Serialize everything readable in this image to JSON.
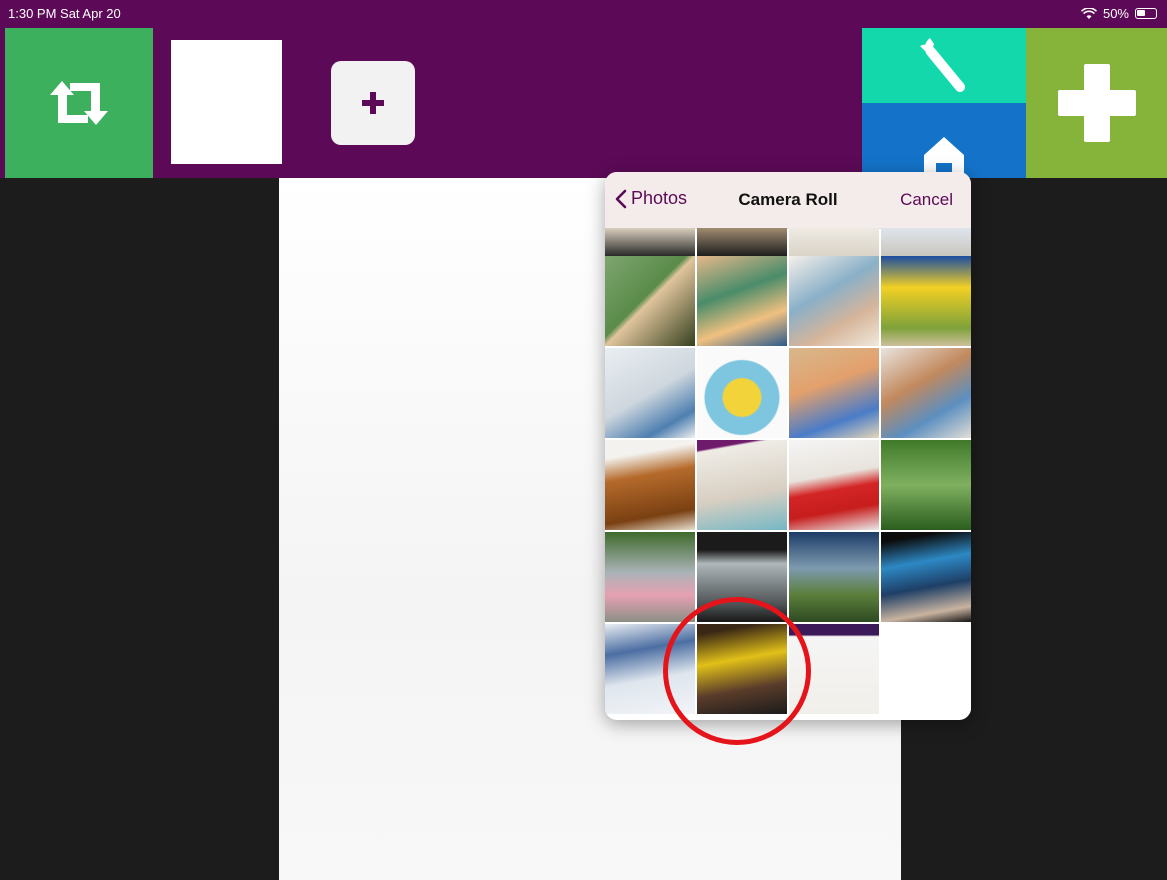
{
  "status_bar": {
    "time": "1:30 PM  Sat Apr 20",
    "battery_percent": "50%"
  },
  "toolbar": {
    "swap_icon": "swap-arrows-icon",
    "add_small_icon": "plus-icon",
    "wrench_icon": "wrench-icon",
    "home_icon": "home-icon",
    "add_big_icon": "plus-icon"
  },
  "photo_picker": {
    "back_label": "Photos",
    "title": "Camera Roll",
    "cancel_label": "Cancel",
    "thumbnail_count": 20
  },
  "colors": {
    "toolbar_purple": "#5c0a57",
    "swap_green": "#3cb05d",
    "wrench_teal": "#12d8ac",
    "home_blue": "#1473c9",
    "add_olive": "#86b43a",
    "highlight_red": "#e5131a"
  }
}
